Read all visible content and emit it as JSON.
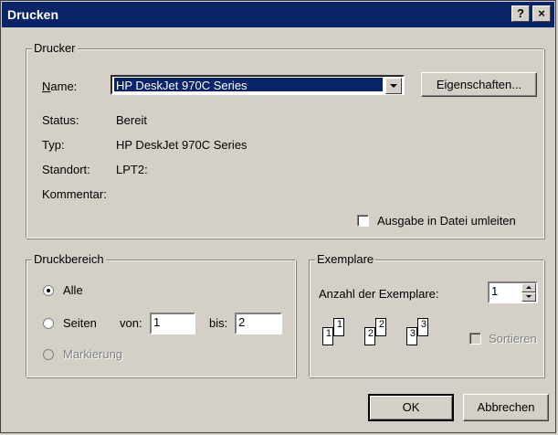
{
  "window": {
    "title": "Drucken",
    "help_label": "?",
    "close_label": "×"
  },
  "drucker": {
    "legend": "Drucker",
    "name_label": "Name:",
    "name_value": "HP DeskJet 970C Series",
    "properties_button": "Eigenschaften...",
    "status_label": "Status:",
    "status_value": "Bereit",
    "type_label": "Typ:",
    "type_value": "HP DeskJet 970C Series",
    "location_label": "Standort:",
    "location_value": "LPT2:",
    "comment_label": "Kommentar:",
    "print_to_file_label": "Ausgabe in Datei umleiten"
  },
  "druckbereich": {
    "legend": "Druckbereich",
    "all_label": "Alle",
    "pages_label": "Seiten",
    "from_label": "von:",
    "from_value": "1",
    "to_label": "bis:",
    "to_value": "2",
    "selection_label": "Markierung"
  },
  "exemplare": {
    "legend": "Exemplare",
    "count_label": "Anzahl der Exemplare:",
    "count_value": "1",
    "collate_label": "Sortieren",
    "page_numbers": [
      "1",
      "1",
      "2",
      "2",
      "3",
      "3"
    ]
  },
  "buttons": {
    "ok": "OK",
    "cancel": "Abbrechen"
  }
}
